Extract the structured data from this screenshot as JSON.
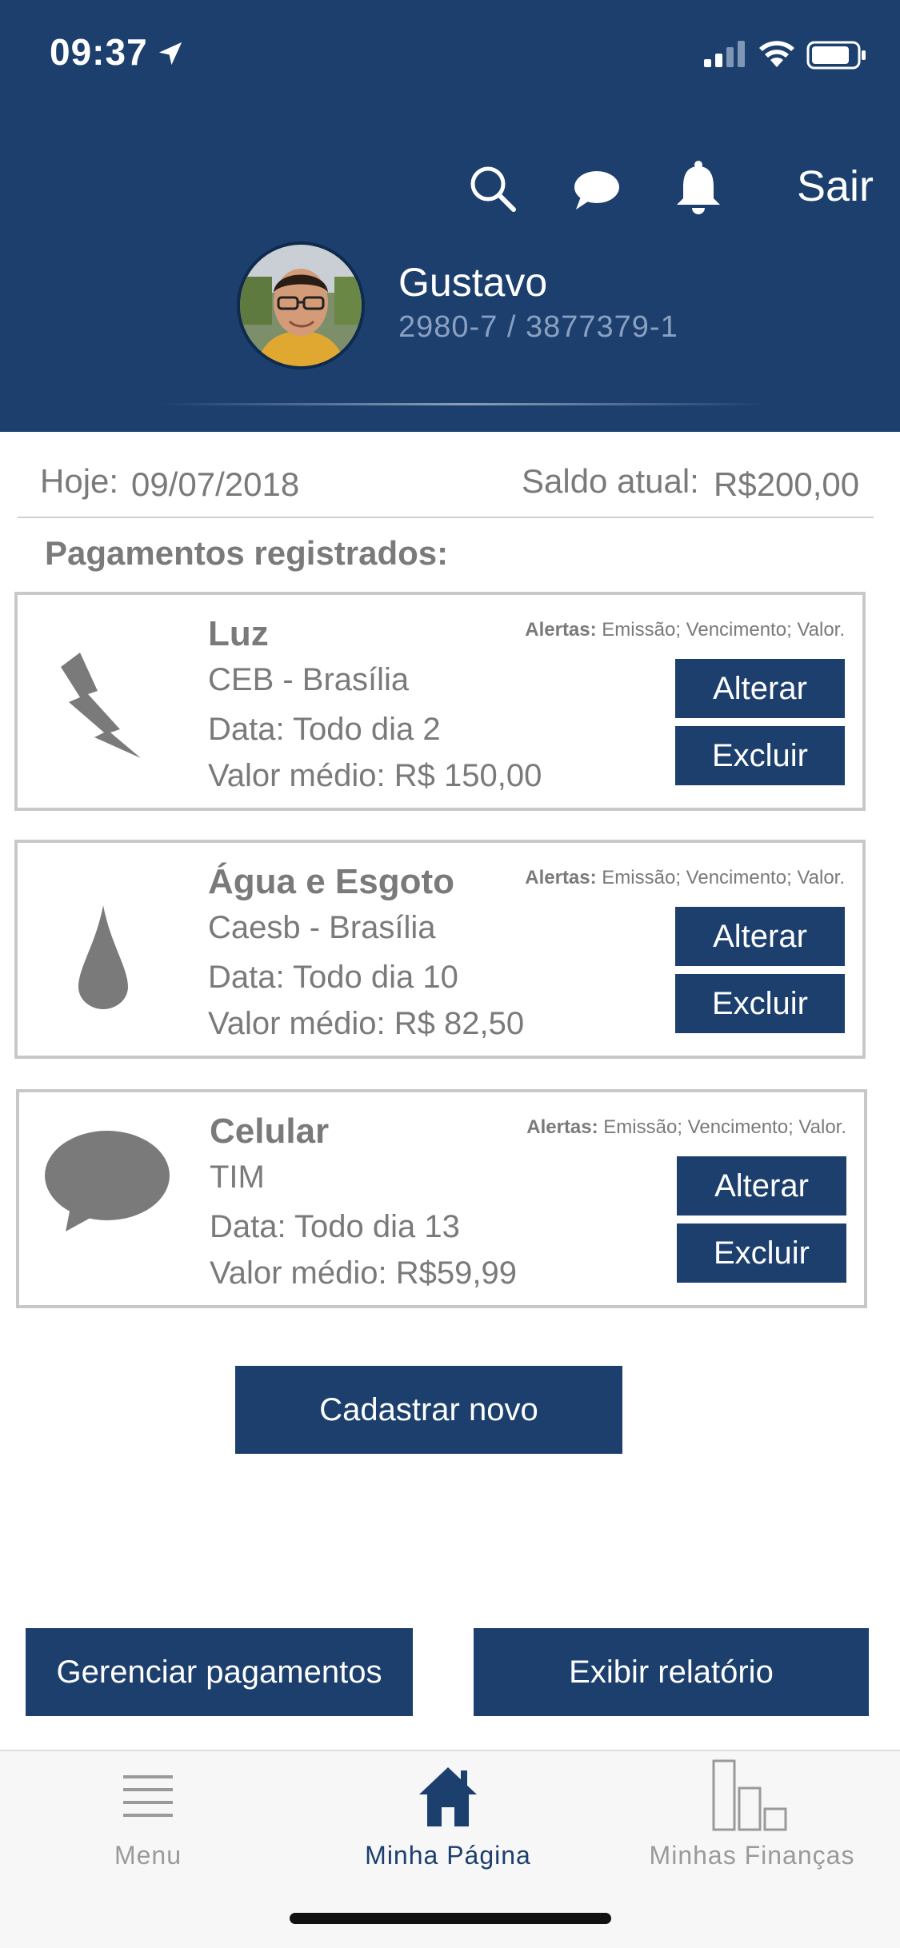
{
  "status": {
    "time": "09:37"
  },
  "header": {
    "logout_label": "Sair",
    "user_name": "Gustavo",
    "account": "2980-7 / 3877379-1",
    "brand_color": "#1c3f6e"
  },
  "info": {
    "today_label": "Hoje:",
    "today_value": "09/07/2018",
    "balance_label": "Saldo atual:",
    "balance_value": "R$200,00"
  },
  "section_title": "Pagamentos registrados:",
  "payments": [
    {
      "icon": "lightning-icon",
      "title": "Luz",
      "provider": "CEB - Brasília",
      "date_label": "Data:",
      "date_value": "Todo dia 2",
      "value_label": "Valor médio:",
      "value": "R$ 150,00",
      "alerts_label": "Alertas:",
      "alerts": "Emissão; Vencimento; Valor.",
      "edit_label": "Alterar",
      "delete_label": "Excluir"
    },
    {
      "icon": "water-drop-icon",
      "title": "Água e Esgoto",
      "provider": "Caesb - Brasília",
      "date_label": "Data:",
      "date_value": "Todo dia 10",
      "value_label": "Valor médio:",
      "value": "R$ 82,50",
      "alerts_label": "Alertas:",
      "alerts": "Emissão; Vencimento; Valor.",
      "edit_label": "Alterar",
      "delete_label": "Excluir"
    },
    {
      "icon": "speech-bubble-icon",
      "title": "Celular",
      "provider": "TIM",
      "date_label": "Data:",
      "date_value": "Todo dia 13",
      "value_label": "Valor médio:",
      "value": "R$59,99",
      "alerts_label": "Alertas:",
      "alerts": "Emissão; Vencimento; Valor.",
      "edit_label": "Alterar",
      "delete_label": "Excluir"
    }
  ],
  "actions": {
    "new_label": "Cadastrar novo",
    "manage_label": "Gerenciar pagamentos",
    "report_label": "Exibir relatório"
  },
  "tabs": [
    {
      "label": "Menu",
      "icon": "hamburger-icon",
      "active": false
    },
    {
      "label": "Minha Página",
      "icon": "home-icon",
      "active": true
    },
    {
      "label": "Minhas Finanças",
      "icon": "bar-chart-icon",
      "active": false
    }
  ]
}
